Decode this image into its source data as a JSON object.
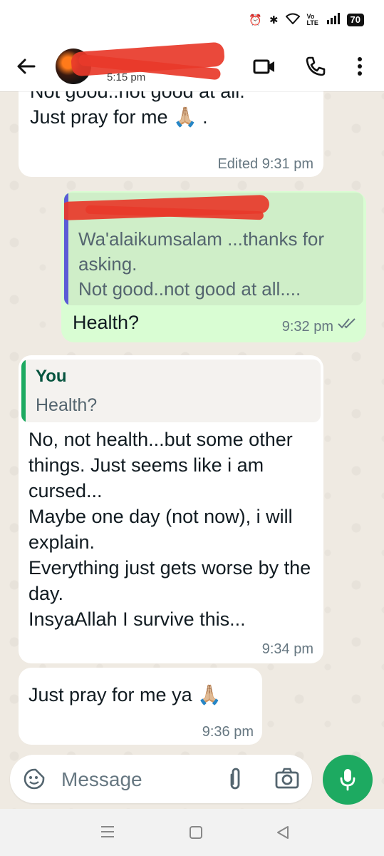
{
  "status_bar": {
    "battery": "70",
    "network_label": "Vo LTE"
  },
  "header": {
    "contact_name": "",
    "last_seen": "5:15 pm"
  },
  "messages": [
    {
      "direction": "incoming",
      "text": "Not good..not good at all.\nJust pray for me 🙏🏼 .",
      "meta": "Edited 9:31 pm"
    },
    {
      "direction": "outgoing",
      "quote_text": "Wa'alaikumsalam ...thanks for asking.\nNot good..not good at all....",
      "text": "Health?",
      "meta": "9:32 pm",
      "status": "read"
    },
    {
      "direction": "incoming",
      "quote_author": "You",
      "quote_text": "Health?",
      "text": "No, not health...but some other things. Just seems like i am cursed...\nMaybe one day (not now), i will explain.\nEverything just gets worse by the day.\nInsyaAllah I survive this...",
      "meta": "9:34 pm"
    },
    {
      "direction": "incoming",
      "text": "Just pray for me ya 🙏🏼",
      "meta": "9:36 pm"
    }
  ],
  "composer": {
    "placeholder": "Message"
  },
  "icons": {
    "back": "back-arrow-icon",
    "video": "video-call-icon",
    "call": "phone-icon",
    "menu": "more-vert-icon",
    "sticker": "sticker-icon",
    "attach": "attach-icon",
    "camera": "camera-icon",
    "mic": "mic-icon"
  },
  "colors": {
    "accent_green": "#1daa61",
    "outgoing_bubble": "#d9fdd3",
    "chat_background": "#efeae2",
    "quote_author_green": "#06543f",
    "redaction": "#e8392a"
  }
}
